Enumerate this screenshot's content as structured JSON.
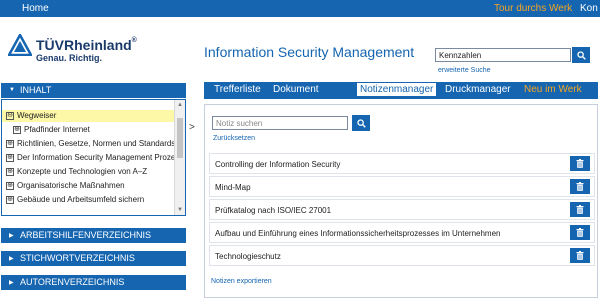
{
  "topnav": {
    "home": "Home",
    "tour": "Tour durchs Werk",
    "cut": "Kon"
  },
  "brand": {
    "name": "TÜVRheinland",
    "registered": "®",
    "slogan": "Genau. Richtig."
  },
  "page": {
    "title": "Information Security Management"
  },
  "search": {
    "value": "Kennzahlen",
    "advanced": "erweiterte Suche"
  },
  "sidebar": {
    "inhalt": "INHALT",
    "toc": [
      {
        "label": "Wegweiser",
        "exp": "⊖"
      },
      {
        "label": "Pfadfinder Internet",
        "exp": "⊕"
      },
      {
        "label": "Richtlinien, Gesetze, Normen und Standards",
        "exp": "⊕"
      },
      {
        "label": "Der Information Security Management Prozess",
        "exp": "⊕"
      },
      {
        "label": "Konzepte und Technologien von A–Z",
        "exp": "⊕"
      },
      {
        "label": "Organisatorische Maßnahmen",
        "exp": "⊕"
      },
      {
        "label": "Gebäude und Arbeitsumfeld sichern",
        "exp": "⊕"
      }
    ],
    "sections": [
      "ARBEITSHILFENVERZEICHNIS",
      "STICHWORTVERZEICHNIS",
      "AUTORENVERZEICHNIS"
    ],
    "collapse": ">"
  },
  "tabs": [
    {
      "label": "Trefferliste"
    },
    {
      "label": "Dokument"
    },
    {
      "label": "Notizenmanager"
    },
    {
      "label": "Druckmanager"
    },
    {
      "label": "Neu im Werk"
    }
  ],
  "notes": {
    "placeholder": "Notiz suchen",
    "reset": "Zurücksetzen",
    "items": [
      "Controlling der Information Security",
      "Mind-Map",
      "Prüfkatalog nach ISO/IEC 27001",
      "Aufbau und Einführung eines Informationssicherheitsprozesses im Unternehmen",
      "Technologieschutz"
    ],
    "export": "Notizen exportieren"
  },
  "colors": {
    "primary": "#1565b0",
    "accent": "#f5a623",
    "highlight": "#fdf7a8"
  },
  "icons": {
    "search": "search-icon",
    "trash": "trash-icon",
    "logo": "tuv-triangle-logo"
  }
}
